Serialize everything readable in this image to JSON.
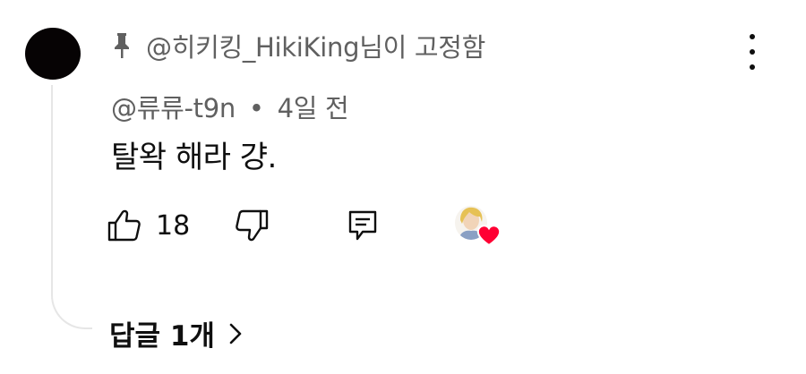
{
  "comment": {
    "pinned_label": "@히키킹_HikiKing님이 고정함",
    "author": "@류류-t9n",
    "separator": "•",
    "timestamp": "4일 전",
    "text": "탈왁 해라 걍.",
    "like_count": "18",
    "replies_label": "답글 1개"
  },
  "icons": {
    "pin": "pin-icon",
    "more": "more-vertical-icon",
    "like": "thumbs-up-icon",
    "dislike": "thumbs-down-icon",
    "reply": "reply-icon",
    "creator_heart": "creator-heart-icon",
    "chevron": "chevron-right-icon"
  },
  "colors": {
    "text_primary": "#0f0f0f",
    "text_secondary": "#606060",
    "heart": "#ff0033"
  }
}
